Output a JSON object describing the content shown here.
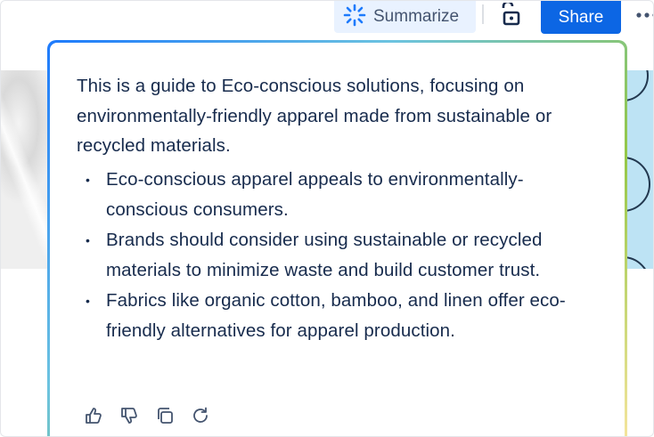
{
  "toolbar": {
    "summarize_label": "Summarize",
    "share_label": "Share"
  },
  "summary": {
    "intro": "This is a guide to Eco-conscious solutions, focusing on environmentally-friendly apparel made from sustainable or recycled materials.",
    "points": [
      "Eco-conscious apparel appeals to environmentally-conscious consumers.",
      "Brands should consider using sustainable or recycled materials to minimize waste and build customer trust.",
      "Fabrics like organic cotton, bamboo, and linen offer eco-friendly alternatives for apparel production."
    ]
  },
  "icons": {
    "summarize": "sparkle-icon",
    "lock": "unlock-icon",
    "more": "more-dots-icon",
    "thumbs_up": "thumbs-up-icon",
    "thumbs_down": "thumbs-down-icon",
    "copy": "copy-icon",
    "retry": "refresh-icon"
  },
  "colors": {
    "accent": "#0c66e4",
    "summarize_bg": "#e9f2ff",
    "text": "#172b4d",
    "icon": "#44546f"
  }
}
